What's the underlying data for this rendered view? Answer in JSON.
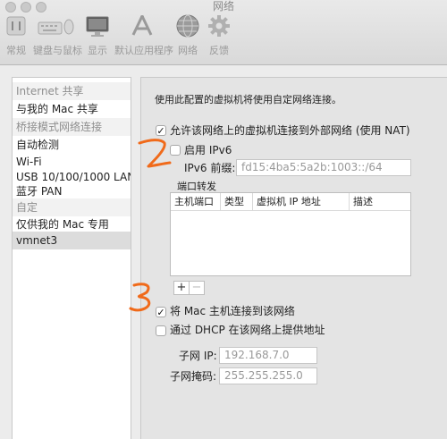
{
  "window": {
    "title": "网络"
  },
  "toolbar": {
    "items": [
      {
        "label": "常规",
        "icon": "general-icon"
      },
      {
        "label": "键盘与鼠标",
        "icon": "keyboard-mouse-icon"
      },
      {
        "label": "显示",
        "icon": "display-icon"
      },
      {
        "label": "默认应用程序",
        "icon": "default-apps-icon"
      },
      {
        "label": "网络",
        "icon": "network-globe-icon"
      },
      {
        "label": "反馈",
        "icon": "feedback-gear-icon"
      }
    ]
  },
  "sidebar": {
    "items": [
      {
        "label": "Internet 共享",
        "kind": "header"
      },
      {
        "label": "与我的 Mac 共享",
        "kind": "item"
      },
      {
        "label": "桥接模式网络连接",
        "kind": "header"
      },
      {
        "label": "自动检测",
        "kind": "item"
      },
      {
        "label": "Wi-Fi",
        "kind": "item"
      },
      {
        "label": "USB 10/100/1000 LAN",
        "kind": "item"
      },
      {
        "label": "蓝牙 PAN",
        "kind": "item"
      },
      {
        "label": "自定",
        "kind": "header"
      },
      {
        "label": "仅供我的 Mac 专用",
        "kind": "item"
      },
      {
        "label": "vmnet3",
        "kind": "item",
        "selected": true
      }
    ]
  },
  "panel": {
    "description": "使用此配置的虚拟机将使用自定网络连接。",
    "allow_nat": {
      "label": "允许该网络上的虚拟机连接到外部网络 (使用 NAT)",
      "checked": true,
      "mark": "✓"
    },
    "enable_ipv6": {
      "label": "启用 IPv6",
      "checked": false
    },
    "ipv6_prefix": {
      "label": "IPv6 前缀:",
      "value": "fd15:4ba5:5a2b:1003::/64"
    },
    "port_forwarding": {
      "label": "端口转发",
      "columns": [
        "主机端口",
        "类型",
        "虚拟机 IP 地址",
        "描述"
      ],
      "add_label": "+",
      "remove_label": "−"
    },
    "connect_mac": {
      "label": "将 Mac 主机连接到该网络",
      "checked": true,
      "mark": "✓"
    },
    "dhcp": {
      "label": "通过 DHCP 在该网络上提供地址",
      "checked": false
    },
    "subnet_ip": {
      "label": "子网 IP:",
      "value": "192.168.7.0"
    },
    "subnet_mask": {
      "label": "子网掩码:",
      "value": "255.255.255.0"
    }
  },
  "annotations": {
    "color": "#f06a1a"
  }
}
